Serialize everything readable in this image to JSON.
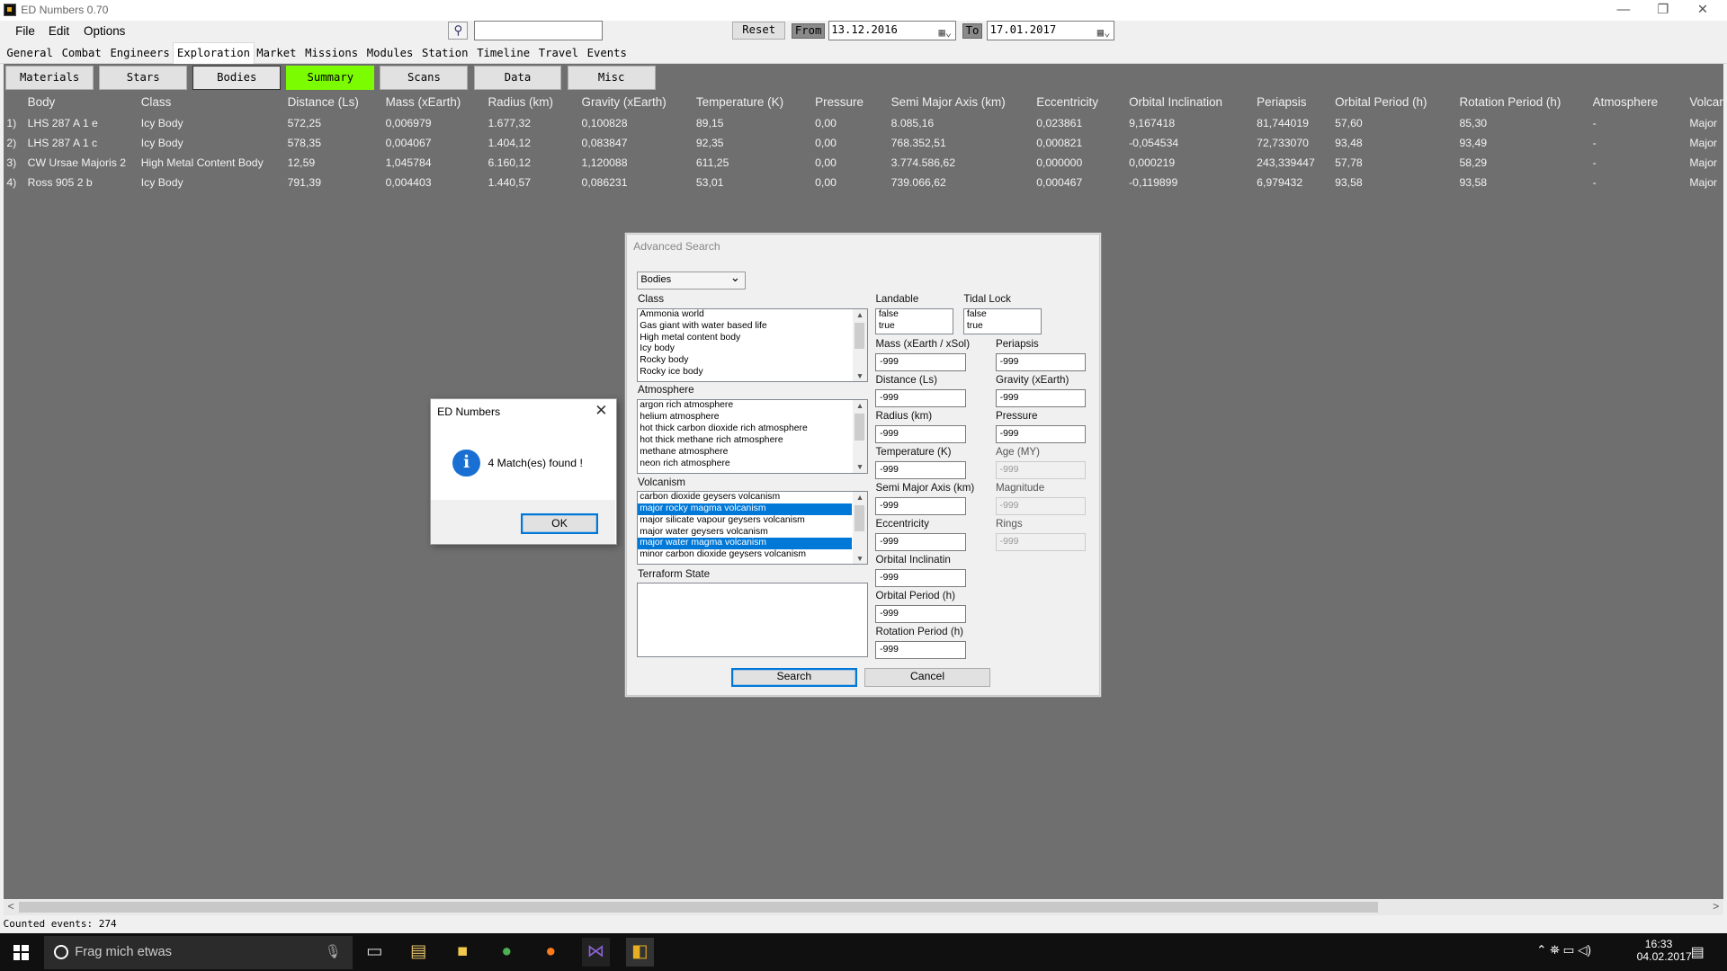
{
  "window": {
    "title": "ED Numbers 0.70",
    "minimize": "—",
    "restore": "❐",
    "close": "✕"
  },
  "menu": [
    "File",
    "Edit",
    "Options"
  ],
  "toolbar": {
    "search_icon": "search-icon",
    "reset": "Reset",
    "from_label": "From",
    "from_date": "13.12.2016",
    "to_label": "To",
    "to_date": "17.01.2017"
  },
  "tabs": [
    "General",
    "Combat",
    "Engineers",
    "Exploration",
    "Market",
    "Missions",
    "Modules",
    "Station",
    "Timeline",
    "Travel",
    "Events"
  ],
  "active_tab": "Exploration",
  "subtabs": [
    "Materials",
    "Stars",
    "Bodies",
    "Summary",
    "Scans",
    "Data",
    "Misc"
  ],
  "table": {
    "columns": [
      "Body",
      "Class",
      "Distance (Ls)",
      "Mass (xEarth)",
      "Radius (km)",
      "Gravity (xEarth)",
      "Temperature (K)",
      "Pressure",
      "Semi Major Axis (km)",
      "Eccentricity",
      "Orbital Inclination",
      "Periapsis",
      "Orbital Period (h)",
      "Rotation Period (h)",
      "Atmosphere",
      "Volcan"
    ],
    "rows": [
      [
        "1)",
        "LHS 287 A 1 e",
        "Icy Body",
        "572,25",
        "0,006979",
        "1.677,32",
        "0,100828",
        "89,15",
        "0,00",
        "8.085,16",
        "0,023861",
        "9,167418",
        "81,744019",
        "57,60",
        "85,30",
        "-",
        "Major"
      ],
      [
        "2)",
        "LHS 287 A 1 c",
        "Icy Body",
        "578,35",
        "0,004067",
        "1.404,12",
        "0,083847",
        "92,35",
        "0,00",
        "768.352,51",
        "0,000821",
        "-0,054534",
        "72,733070",
        "93,48",
        "93,49",
        "-",
        "Major"
      ],
      [
        "3)",
        "CW Ursae Majoris 2",
        "High Metal Content Body",
        "12,59",
        "1,045784",
        "6.160,12",
        "1,120088",
        "611,25",
        "0,00",
        "3.774.586,62",
        "0,000000",
        "0,000219",
        "243,339447",
        "57,78",
        "58,29",
        "-",
        "Major"
      ],
      [
        "4)",
        "Ross 905 2 b",
        "Icy Body",
        "791,39",
        "0,004403",
        "1.440,57",
        "0,086231",
        "53,01",
        "0,00",
        "739.066,62",
        "0,000467",
        "-0,119899",
        "6,979432",
        "93,58",
        "93,58",
        "-",
        "Major"
      ]
    ]
  },
  "status": "Counted events: 274",
  "advanced_search": {
    "title": "Advanced Search",
    "type_select": "Bodies",
    "class_label": "Class",
    "class_items": [
      "Ammonia world",
      "Gas giant with water based life",
      "High metal content body",
      "Icy body",
      "Rocky body",
      "Rocky ice body"
    ],
    "atmosphere_label": "Atmosphere",
    "atmosphere_items": [
      "argon rich atmosphere",
      "helium atmosphere",
      "hot thick carbon dioxide rich atmosphere",
      "hot thick methane rich atmosphere",
      "methane atmosphere",
      "neon rich atmosphere"
    ],
    "volcanism_label": "Volcanism",
    "volcanism_items": [
      "carbon dioxide geysers volcanism",
      "major rocky magma volcanism",
      "major silicate vapour geysers volcanism",
      "major water geysers volcanism",
      "major water magma volcanism",
      "minor carbon dioxide geysers volcanism"
    ],
    "volcanism_selected": [
      1,
      4
    ],
    "terraform_label": "Terraform State",
    "landable_label": "Landable",
    "landable_items": [
      "false",
      "true"
    ],
    "tidal_label": "Tidal Lock",
    "tidal_items": [
      "false",
      "true"
    ],
    "fields_left": [
      {
        "label": "Mass (xEarth / xSol)",
        "value": "-999"
      },
      {
        "label": "Distance (Ls)",
        "value": "-999"
      },
      {
        "label": "Radius (km)",
        "value": "-999"
      },
      {
        "label": "Temperature (K)",
        "value": "-999"
      },
      {
        "label": "Semi Major Axis (km)",
        "value": "-999"
      },
      {
        "label": "Eccentricity",
        "value": "-999"
      },
      {
        "label": "Orbital Inclinatin",
        "value": "-999"
      },
      {
        "label": "Orbital Period (h)",
        "value": "-999"
      },
      {
        "label": "Rotation Period (h)",
        "value": "-999"
      }
    ],
    "fields_right": [
      {
        "label": "Periapsis",
        "value": "-999"
      },
      {
        "label": "Gravity (xEarth)",
        "value": "-999"
      },
      {
        "label": "Pressure",
        "value": "-999"
      },
      {
        "label": "Age (MY)",
        "value": "-999"
      },
      {
        "label": "Magnitude",
        "value": "-999"
      },
      {
        "label": "Rings",
        "value": "-999"
      }
    ],
    "search_btn": "Search",
    "cancel_btn": "Cancel"
  },
  "messagebox": {
    "title": "ED Numbers",
    "text": "4 Match(es) found !",
    "ok": "OK"
  },
  "taskbar": {
    "search_placeholder": "Frag mich etwas",
    "time": "16:33",
    "date": "04.02.2017"
  }
}
